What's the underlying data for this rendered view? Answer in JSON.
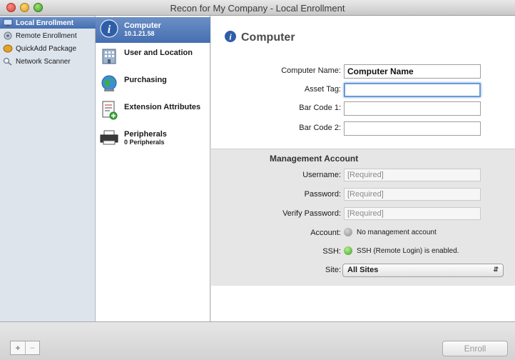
{
  "window": {
    "title": "Recon for My Company - Local Enrollment"
  },
  "sidebar": {
    "items": [
      {
        "label": "Local Enrollment",
        "icon": "monitor-icon",
        "selected": true
      },
      {
        "label": "Remote Enrollment",
        "icon": "network-icon",
        "selected": false
      },
      {
        "label": "QuickAdd Package",
        "icon": "package-icon",
        "selected": false
      },
      {
        "label": "Network Scanner",
        "icon": "magnifier-icon",
        "selected": false
      }
    ]
  },
  "categories": [
    {
      "label": "Computer",
      "sub": "10.1.21.58",
      "icon": "info-icon",
      "selected": true
    },
    {
      "label": "User and Location",
      "sub": "",
      "icon": "building-icon",
      "selected": false
    },
    {
      "label": "Purchasing",
      "sub": "",
      "icon": "globe-icon",
      "selected": false
    },
    {
      "label": "Extension Attributes",
      "sub": "",
      "icon": "document-add-icon",
      "selected": false
    },
    {
      "label": "Peripherals",
      "sub": "0 Peripherals",
      "icon": "printer-icon",
      "selected": false
    }
  ],
  "detail": {
    "title": "Computer",
    "fields": [
      {
        "label": "Computer Name:",
        "value": "Computer Name"
      },
      {
        "label": "Asset Tag:",
        "value": ""
      },
      {
        "label": "Bar Code 1:",
        "value": ""
      },
      {
        "label": "Bar Code 2:",
        "value": ""
      }
    ],
    "management": {
      "title": "Management Account",
      "username_label": "Username:",
      "username_placeholder": "[Required]",
      "password_label": "Password:",
      "password_placeholder": "[Required]",
      "verify_label": "Verify Password:",
      "verify_placeholder": "[Required]",
      "account_label": "Account:",
      "account_status": "No management account",
      "account_color": "#9a9a9a",
      "ssh_label": "SSH:",
      "ssh_status": "SSH (Remote Login) is enabled.",
      "ssh_color": "#58c232",
      "site_label": "Site:",
      "site_value": "All Sites"
    }
  },
  "footer": {
    "add": "+",
    "remove": "−",
    "enroll": "Enroll"
  }
}
